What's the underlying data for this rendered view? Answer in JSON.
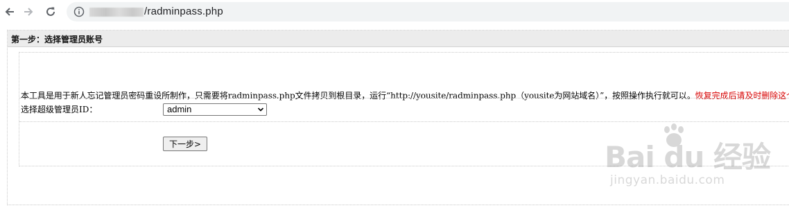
{
  "browser": {
    "url_blurred_host": "",
    "url_path": "/radminpass.php"
  },
  "step": {
    "title": "第一步：选择管理员账号"
  },
  "description": {
    "text": "本工具是用于新人忘记管理员密码重设所制作，只需要将radminpass.php文件拷贝到根目录，运行“http://yousite/radminpass.php（yousite为网站域名）”，按照操作执行就可以。",
    "warning": "恢复完成后请及时删除这个文件!"
  },
  "form": {
    "admin_label": "选择超级管理员ID：",
    "admin_select_value": "admin",
    "next_button": "下一步>"
  },
  "watermark": {
    "brand": "Bai  du 经验",
    "sub": "jingyan.baidu.com"
  },
  "icons": {
    "back": "arrow-left-icon",
    "forward": "arrow-right-icon",
    "reload": "reload-icon",
    "info": "info-icon",
    "dropdown": "chevron-down-icon"
  }
}
